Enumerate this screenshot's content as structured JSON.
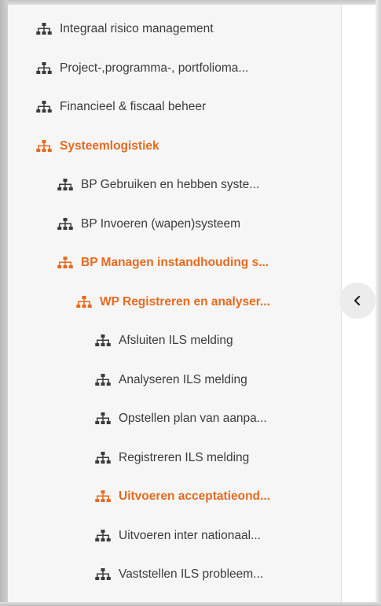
{
  "colors": {
    "active": "#e66a1f",
    "normal": "#3c3c3c"
  },
  "tree": {
    "items": [
      {
        "label": "Integraal risico management",
        "active": false,
        "level": 0
      },
      {
        "label": "Project-,programma-, portfolioma...",
        "active": false,
        "level": 0
      },
      {
        "label": "Financieel & fiscaal beheer",
        "active": false,
        "level": 0
      },
      {
        "label": "Systeemlogistiek",
        "active": true,
        "level": 0
      },
      {
        "label": "BP Gebruiken en hebben syste...",
        "active": false,
        "level": 1
      },
      {
        "label": "BP Invoeren (wapen)systeem",
        "active": false,
        "level": 1
      },
      {
        "label": "BP Managen instandhouding s...",
        "active": true,
        "level": 1
      },
      {
        "label": "WP Registreren en analyser...",
        "active": true,
        "level": 2
      },
      {
        "label": "Afsluiten ILS melding",
        "active": false,
        "level": 3
      },
      {
        "label": "Analyseren ILS melding",
        "active": false,
        "level": 3
      },
      {
        "label": "Opstellen plan van aanpa...",
        "active": false,
        "level": 3
      },
      {
        "label": "Registreren ILS melding",
        "active": false,
        "level": 3
      },
      {
        "label": "Uitvoeren acceptatieond...",
        "active": true,
        "level": 3
      },
      {
        "label": "Uitvoeren inter nationaal...",
        "active": false,
        "level": 3
      },
      {
        "label": "Vaststellen ILS probleem...",
        "active": false,
        "level": 3
      }
    ]
  },
  "collapse_button": {
    "icon": "chevron-left-icon"
  }
}
